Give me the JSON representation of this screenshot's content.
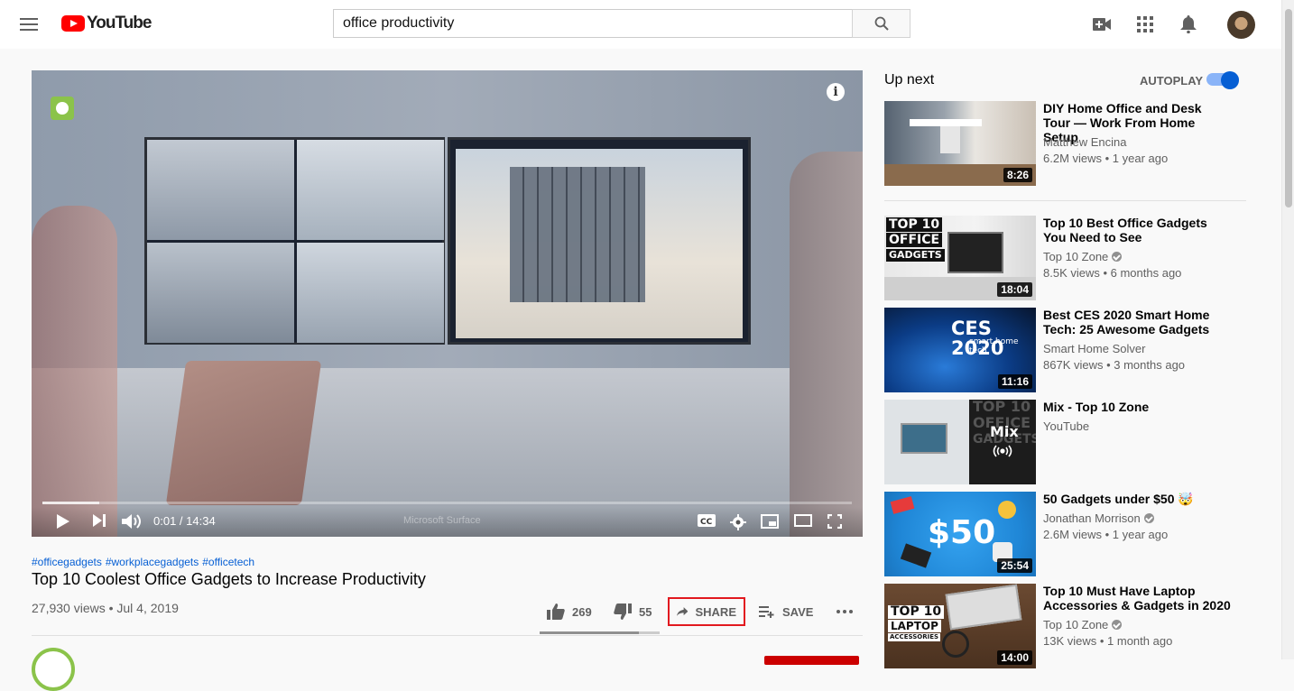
{
  "header": {
    "logo_text": "YouTube",
    "search_value": "office productivity",
    "icons": [
      "menu-icon",
      "search-icon",
      "create-video-icon",
      "apps-icon",
      "notifications-icon"
    ]
  },
  "player": {
    "time": "0:01 / 14:34",
    "progress": 0.07,
    "watermark": "Microsoft Surface",
    "colors": {
      "accent": "#ff0000"
    }
  },
  "video": {
    "hashtags": [
      "#officegadgets",
      "#workplacegadgets",
      "#officetech"
    ],
    "title": "Top 10 Coolest Office Gadgets to Increase Productivity",
    "views": "27,930 views • Jul 4, 2019",
    "likes": "269",
    "dislikes": "55",
    "like_ratio": 0.83,
    "share_label": "SHARE",
    "save_label": "SAVE"
  },
  "sidebar": {
    "up_next_label": "Up next",
    "autoplay_label": "AUTOPLAY",
    "autoplay_on": true,
    "items": [
      {
        "title": "DIY Home Office and Desk Tour — Work From Home Setup",
        "channel": "Matthew Encina",
        "meta": "6.2M views • 1 year ago",
        "duration": "8:26",
        "verified": false
      },
      {
        "title": "Top 10 Best Office Gadgets You Need to See",
        "channel": "Top 10 Zone",
        "meta": "8.5K views • 6 months ago",
        "duration": "18:04",
        "verified": true,
        "thumb_text": [
          "TOP 10",
          "OFFICE",
          "GADGETS"
        ]
      },
      {
        "title": "Best CES 2020 Smart Home Tech: 25 Awesome Gadgets",
        "channel": "Smart Home Solver",
        "meta": "867K views • 3 months ago",
        "duration": "11:16",
        "verified": false,
        "thumb_text": [
          "CES 2020",
          "smart home tech"
        ]
      },
      {
        "title": "Mix - Top 10 Zone",
        "channel": "YouTube",
        "meta": "",
        "duration": "",
        "verified": false,
        "thumb_text": [
          "Mix",
          "TOP 10",
          "OFFICE",
          "GADGETS"
        ]
      },
      {
        "title": "50 Gadgets under $50 🤯",
        "channel": "Jonathan Morrison",
        "meta": "2.6M views • 1 year ago",
        "duration": "25:54",
        "verified": true,
        "thumb_text": [
          "$50"
        ]
      },
      {
        "title": "Top 10 Must Have Laptop Accessories & Gadgets in 2020",
        "channel": "Top 10 Zone",
        "meta": "13K views • 1 month ago",
        "duration": "14:00",
        "verified": true,
        "thumb_text": [
          "TOP 10",
          "LAPTOP",
          "ACCESSORIES"
        ]
      }
    ]
  }
}
